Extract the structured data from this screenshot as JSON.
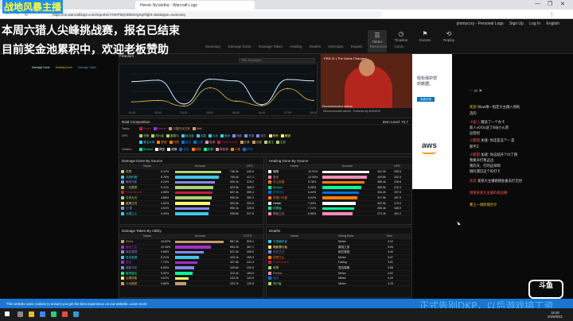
{
  "browser": {
    "tab_title": "Heroic Ny'alotha - Warcraft Logs",
    "url": "https://cn.warcraftlogs.com/reports/rYNmP9QHDkMVgXq#fight=last&type=summary",
    "window_controls": [
      "—",
      "❐",
      "✕"
    ]
  },
  "header": {
    "user": "jimmycrzy - Personal Logs",
    "links": [
      "Sign Up",
      "Log In",
      "English"
    ],
    "nav": [
      {
        "icon": "list-icon",
        "label": "Tables",
        "active": true
      },
      {
        "icon": "timeline-icon",
        "label": "Timeline",
        "active": false
      },
      {
        "icon": "events-icon",
        "label": "Events",
        "active": false
      },
      {
        "icon": "rewind-icon",
        "label": "Replay",
        "active": false
      }
    ],
    "subnav": [
      "Summary",
      "Damage Done",
      "Damage Taken",
      "Healing",
      "Deaths",
      "Interrupts",
      "Dispels",
      "Resources",
      "Casts"
    ]
  },
  "overlay": {
    "top": "战地风暴主播",
    "line1": "本周六猎人尖峰挑战赛，报名已结束",
    "line2": "目前奖金池累积中，欢迎老板赞助",
    "bottom": "正式告别DKP，以后游戏搞工资",
    "corner_logo": "斗鱼"
  },
  "chart": {
    "panel_title": "Freedom",
    "filter": "Filter Expression",
    "legend": [
      "Damage Done",
      "Healing Done",
      "Damage Taken"
    ],
    "x_ticks": [
      "01:00",
      "02:00",
      "03:00",
      "04:00",
      "05:00",
      "06:00",
      "07:00",
      "08:00"
    ],
    "colors": {
      "dps": "#c8e8ff",
      "heal": "#e8b830",
      "taken": "#4aa0c0"
    }
  },
  "chart_data": {
    "type": "line",
    "title": "",
    "x": [
      "01:00",
      "02:00",
      "03:00",
      "04:00",
      "05:00",
      "06:00",
      "07:00",
      "08:00"
    ],
    "series": [
      {
        "name": "Damage Done",
        "values": [
          78,
          82,
          14,
          85,
          80,
          12,
          84,
          80
        ]
      },
      {
        "name": "Healing Done",
        "values": [
          20,
          24,
          8,
          60,
          22,
          9,
          58,
          24
        ]
      }
    ],
    "ylim": [
      0,
      100
    ]
  },
  "ad_video": {
    "title": "FIFA 21 | The Game Changers",
    "cta": "Recommended videos",
    "caption": "Recommended videos  ·  Powered by ANIVIEW"
  },
  "raid": {
    "title": "Raid Composition",
    "item_level": "Item Level: 72.7",
    "rows": [
      {
        "label": "Tanks",
        "specs": [
          [
            "Death",
            "#c41e3a"
          ],
          [
            "Demon",
            "#a330c9"
          ],
          [
            "中国的北方狼",
            "#c69b6d"
          ],
          [
            "Wall",
            "#c69b6d"
          ]
        ]
      },
      {
        "label": "DPS",
        "specs": [
          [
            "苍歌",
            "#aad372"
          ],
          [
            "风行者",
            "#aad372"
          ],
          [
            "雷霆弓",
            "#aad372"
          ],
          [
            "破法者",
            "#3fc7eb"
          ],
          [
            "冰霜",
            "#3fc7eb"
          ],
          [
            "火法",
            "#3fc7eb"
          ],
          [
            "奥术",
            "#3fc7eb"
          ],
          [
            "暗影",
            "#8788ee"
          ],
          [
            "恶魔",
            "#8788ee"
          ],
          [
            "毁灭",
            "#8788ee"
          ],
          [
            "刺杀",
            "#fff468"
          ],
          [
            "敏锐",
            "#fff468"
          ]
        ]
      },
      {
        "label": "",
        "specs": [
          [
            "奥法大师",
            "#3fc7eb"
          ],
          [
            "野德",
            "#ff7c0a"
          ],
          [
            "鸟德",
            "#ff7c0a"
          ],
          [
            "增强",
            "#0070dd"
          ],
          [
            "元素",
            "#0070dd"
          ],
          [
            "惩戒",
            "#f48cba"
          ],
          [
            "Rottenshank",
            "#c41e3a"
          ],
          [
            "狂暴",
            "#c69b6d"
          ],
          [
            "武器",
            "#c69b6d"
          ],
          [
            "兽王",
            "#aad372"
          ],
          [
            "生存",
            "#aad372"
          ]
        ]
      },
      {
        "label": "Healers",
        "specs": [
          [
            "Brewmi",
            "#00ff98"
          ],
          [
            "神圣",
            "#ffffff"
          ],
          [
            "戒律",
            "#ffffff"
          ],
          [
            "恢复",
            "#0070dd"
          ],
          [
            "奶德",
            "#ff7c0a"
          ],
          [
            "织雾",
            "#00ff98"
          ],
          [
            "神圣骑",
            "#f48cba"
          ],
          [
            "小德",
            "#ff7c0a"
          ],
          [
            "萨满",
            "#0070dd"
          ]
        ]
      }
    ]
  },
  "damage_done": {
    "title": "Damage Done By Source",
    "headers": [
      "Name",
      "Amount",
      "DPS"
    ],
    "rows": [
      {
        "name": "夜鹰",
        "pct": "6.12%",
        "amount": "746.3k",
        "dps": "440.6",
        "frac": 0.88,
        "color": "#aad372"
      },
      {
        "name": "法師的魔",
        "pct": "5.78%",
        "amount": "705.0k",
        "dps": "417.1",
        "frac": 0.83,
        "color": "#3fc7eb"
      },
      {
        "name": "暗夜月影",
        "pct": "5.24%",
        "amount": "639.1k",
        "dps": "378.2",
        "frac": 0.75,
        "color": "#8788ee"
      },
      {
        "name": "一剑霜寒",
        "pct": "5.11%",
        "amount": "623.5k",
        "dps": "368.9",
        "frac": 0.73,
        "color": "#aad372"
      },
      {
        "name": "Rottenshank",
        "pct": "4.98%",
        "amount": "607.4k",
        "dps": "359.4",
        "frac": 0.71,
        "color": "#c41e3a"
      },
      {
        "name": "月夜无光",
        "pct": "4.88%",
        "amount": "595.2k",
        "dps": "352.2",
        "frac": 0.7,
        "color": "#aad372"
      },
      {
        "name": "疾风之刃",
        "pct": "4.62%",
        "amount": "563.6k",
        "dps": "333.5",
        "frac": 0.66,
        "color": "#fff468"
      },
      {
        "name": "幻·影",
        "pct": "4.51%",
        "amount": "550.1k",
        "dps": "325.5",
        "frac": 0.65,
        "color": "#8788ee"
      },
      {
        "name": "冰霜之心",
        "pct": "4.40%",
        "amount": "536.8k",
        "dps": "317.6",
        "frac": 0.63,
        "color": "#3fc7eb"
      }
    ]
  },
  "healing_done": {
    "title": "Healing Done By Source",
    "headers": [
      "Name",
      "Amount",
      "HPS"
    ],
    "rows": [
      {
        "name": "咖啡",
        "pct": "10.91%",
        "amount": "431.9k",
        "dps": "255.6",
        "frac": 0.9,
        "color": "#ffffff"
      },
      {
        "name": "圣光",
        "pct": "10.35%",
        "amount": "409.8k",
        "dps": "242.5",
        "frac": 0.85,
        "color": "#f48cba"
      },
      {
        "name": "月之祝福",
        "pct": "9.76%",
        "amount": "386.4k",
        "dps": "228.6",
        "frac": 0.8,
        "color": "#ff7c0a"
      },
      {
        "name": "Brewmi",
        "pct": "8.98%",
        "amount": "355.5k",
        "dps": "210.4",
        "frac": 0.74,
        "color": "#00ff98"
      },
      {
        "name": "萨满领主",
        "pct": "8.44%",
        "amount": "334.2k",
        "dps": "197.8",
        "frac": 0.7,
        "color": "#0070dd"
      },
      {
        "name": "奶德小可爱",
        "pct": "8.02%",
        "amount": "317.5k",
        "dps": "187.9",
        "frac": 0.66,
        "color": "#ff7c0a"
      },
      {
        "name": "Healer",
        "pct": "7.64%",
        "amount": "302.5k",
        "dps": "179.0",
        "frac": 0.63,
        "color": "#ffffff"
      },
      {
        "name": "织雾者",
        "pct": "7.21%",
        "amount": "285.4k",
        "dps": "168.9",
        "frac": 0.6,
        "color": "#00ff98"
      },
      {
        "name": "神圣之光",
        "pct": "6.88%",
        "amount": "272.4k",
        "dps": "161.2",
        "frac": 0.57,
        "color": "#f48cba"
      }
    ]
  },
  "damage_taken": {
    "title": "Damage Taken By Ability",
    "headers": [
      "Name",
      "Amount",
      "DTPS"
    ],
    "rows": [
      {
        "name": "Melee",
        "pct": "16.82%",
        "amount": "887.4k",
        "dps": "525.1",
        "frac": 0.92,
        "color": "#c69b6d"
      },
      {
        "name": "腐蚀之息",
        "pct": "12.40%",
        "amount": "654.2k",
        "dps": "387.1",
        "frac": 0.68,
        "color": "#a330c9"
      },
      {
        "name": "疯狂凝视",
        "pct": "9.88%",
        "amount": "521.3k",
        "dps": "308.5",
        "frac": 0.54,
        "color": "#8788ee"
      },
      {
        "name": "混沌裂隙",
        "pct": "8.21%",
        "amount": "433.1k",
        "dps": "256.3",
        "frac": 0.45,
        "color": "#3fc7eb"
      },
      {
        "name": "虚空",
        "pct": "7.73%",
        "amount": "407.8k",
        "dps": "241.3",
        "frac": 0.42,
        "color": "#a330c9"
      },
      {
        "name": "暗影冲击",
        "pct": "6.55%",
        "amount": "345.6k",
        "dps": "204.5",
        "frac": 0.36,
        "color": "#8788ee"
      },
      {
        "name": "触须猛击",
        "pct": "5.92%",
        "amount": "312.4k",
        "dps": "184.9",
        "frac": 0.33,
        "color": "#00ff98"
      },
      {
        "name": "心灵冲击",
        "pct": "4.61%",
        "amount": "243.2k",
        "dps": "143.9",
        "frac": 0.25,
        "color": "#fff468"
      },
      {
        "name": "大地震颤",
        "pct": "3.86%",
        "amount": "203.7k",
        "dps": "120.5",
        "frac": 0.21,
        "color": "#c69b6d"
      }
    ]
  },
  "deaths": {
    "title": "Deaths",
    "headers": [
      "Name",
      "Killing Blow",
      "Time"
    ],
    "rows": [
      {
        "name": "咒语编织者",
        "blow": "Melee",
        "time": "3:12",
        "color": "#3fc7eb"
      },
      {
        "name": "暗影潜行者",
        "blow": "腐蚀之息",
        "time": "3:26",
        "color": "#fff468"
      },
      {
        "name": "月光之刃",
        "blow": "疯狂凝视",
        "time": "3:40",
        "color": "#8788ee"
      },
      {
        "name": "狂野之心",
        "blow": "Melee",
        "time": "3:47",
        "color": "#ff7c0a"
      },
      {
        "name": "Rottenshank",
        "blow": "Falling",
        "time": "3:51",
        "color": "#c41e3a"
      },
      {
        "name": "夜鹰",
        "blow": "混沌裂隙",
        "time": "3:58",
        "color": "#aad372"
      },
      {
        "name": "Freedo",
        "blow": "Melee",
        "time": "4:02",
        "color": "#f48cba"
      },
      {
        "name": "破晓",
        "blow": "Melee",
        "time": "4:10",
        "color": "#0070dd"
      },
      {
        "name": "风行者",
        "blow": "Melee",
        "time": "4:15",
        "color": "#aad372"
      }
    ]
  },
  "ad_right": {
    "text1": "轻松保护您",
    "text2": "的数据。",
    "button": "免费试用",
    "brand": "aws"
  },
  "chat": {
    "header": "♡  ✉  ⚑",
    "lines": [
      {
        "name": "欢迎",
        "text": "Wow唯一指定大主播入场啦",
        "y": 132,
        "c": "n2"
      },
      {
        "name": "",
        "text": "选的",
        "y": 140,
        "c": ""
      },
      {
        "name": "小鱼儿",
        "text": "赠送了一个办卡",
        "y": 151,
        "c": "n"
      },
      {
        "name": "",
        "text": "新人vOOo送了B站小火箭",
        "y": 158,
        "c": ""
      },
      {
        "name": "",
        "text": "运营组",
        "y": 165,
        "c": ""
      },
      {
        "name": "小甜甜",
        "text": "加速: 你还是这个~ 是",
        "y": 174,
        "c": "n"
      },
      {
        "name": "",
        "text": "那不Z",
        "y": 182,
        "c": ""
      },
      {
        "name": "小甜甜",
        "text": "加速: 你这就开个UI了刚",
        "y": 192,
        "c": "n"
      },
      {
        "name": "",
        "text": "我要开打我这边",
        "y": 199,
        "c": ""
      },
      {
        "name": "",
        "text": "我的天，打的这样啊",
        "y": 206,
        "c": ""
      },
      {
        "name": "",
        "text": "刚好遇见这个的打卡",
        "y": 213,
        "c": ""
      },
      {
        "name": "欢迎",
        "text": "某某大主播刚刚准备去打全团",
        "y": 225,
        "c": "n"
      },
      {
        "name": "",
        "text": "谢谢某某大主播的挑战赛",
        "y": 240,
        "c": "n"
      },
      {
        "name": "",
        "text": "算上一场的钱合计",
        "y": 255,
        "c": "n2"
      }
    ]
  },
  "cookie": "This website uses cookies to ensure you get the best experience on our website.  Learn more",
  "taskbar": {
    "time": "18:48",
    "date": "2020/8/22"
  }
}
